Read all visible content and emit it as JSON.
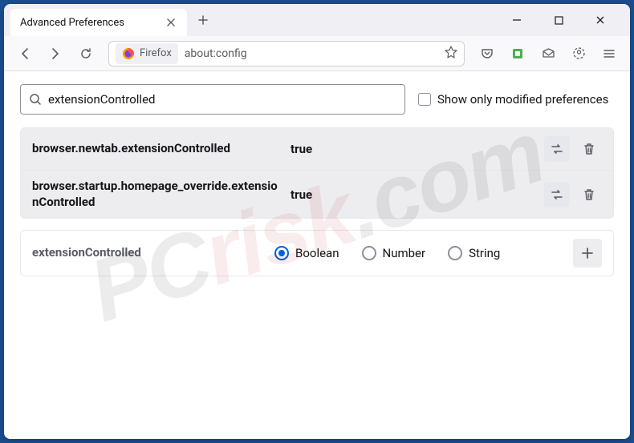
{
  "titlebar": {
    "tab_title": "Advanced Preferences"
  },
  "toolbar": {
    "identity_label": "Firefox",
    "url": "about:config"
  },
  "search": {
    "value": "extensionControlled",
    "checkbox_label": "Show only modified preferences"
  },
  "prefs": [
    {
      "name": "browser.newtab.extensionControlled",
      "value": "true"
    },
    {
      "name": "browser.startup.homepage_override.extensionControlled",
      "value": "true"
    }
  ],
  "new_pref": {
    "name": "extensionControlled",
    "types": {
      "boolean": "Boolean",
      "number": "Number",
      "string": "String"
    }
  },
  "watermark": {
    "a": "PC",
    "b": "risk",
    "c": ".com"
  }
}
